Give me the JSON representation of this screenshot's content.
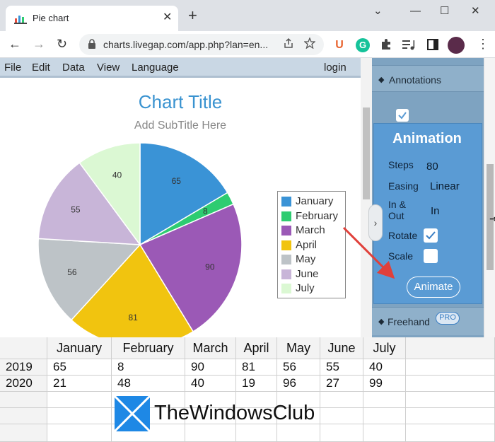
{
  "browser": {
    "tab_title": "Pie chart",
    "tab_close": "✕",
    "new_tab": "+",
    "url": "charts.livegap.com/app.php?lan=en...",
    "back": "←",
    "forward": "→",
    "reload": "↻",
    "window": {
      "minimize": "⌄",
      "minimize2": "—",
      "maximize": "☐",
      "close": "✕"
    },
    "ext_u": "U",
    "ext_g": "G"
  },
  "menu": {
    "items": [
      "File",
      "Edit",
      "Data",
      "View",
      "Language"
    ],
    "login": "login"
  },
  "chart": {
    "title": "Chart Title",
    "subtitle": "Add SubTitle Here"
  },
  "chart_data": {
    "type": "pie",
    "title": "Chart Title",
    "subtitle": "Add SubTitle Here",
    "categories": [
      "January",
      "February",
      "March",
      "April",
      "May",
      "June",
      "July"
    ],
    "values": [
      65,
      8,
      90,
      81,
      56,
      55,
      40
    ],
    "colors": [
      "#3a93d6",
      "#2ecc71",
      "#9b59b6",
      "#f1c40f",
      "#bdc3c7",
      "#c8b5d8",
      "#dbf8d3"
    ],
    "legend": "right"
  },
  "panel": {
    "annotations_label": "Annotations",
    "animation_title": "Animation",
    "steps_label": "Steps",
    "steps_value": "80",
    "easing_label": "Easing",
    "easing_value": "Linear",
    "inout_label_1": "In &",
    "inout_label_2": "Out",
    "inout_value": "In",
    "rotate_label": "Rotate",
    "scale_label": "Scale",
    "animate_button": "Animate",
    "freehand_label": "Freehand",
    "pro_badge": "PRO",
    "collapse": "›"
  },
  "grid": {
    "headers": [
      "January",
      "February",
      "March",
      "April",
      "May",
      "June",
      "July"
    ],
    "rows": [
      {
        "label": "2019",
        "values": [
          "65",
          "8",
          "90",
          "81",
          "56",
          "55",
          "40"
        ]
      },
      {
        "label": "2020",
        "values": [
          "21",
          "48",
          "40",
          "19",
          "96",
          "27",
          "99"
        ]
      }
    ]
  },
  "watermark": "TheWindowsClub",
  "colors": {
    "accent": "#3a93d0",
    "panel": "#7ea3c1",
    "animation_box": "#5a9bd4",
    "arrow": "#e0403a"
  }
}
